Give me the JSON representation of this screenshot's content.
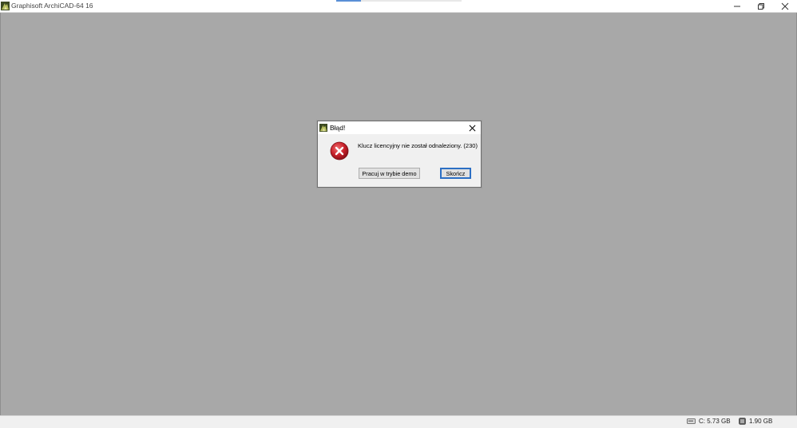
{
  "window": {
    "title": "Graphisoft ArchiCAD-64 16",
    "icon": "archicad-logo-icon",
    "controls": [
      "minimize-icon",
      "restore-icon",
      "close-icon"
    ]
  },
  "dialog": {
    "title": "Błąd!",
    "icon": "archicad-logo-icon",
    "error_icon": "error-icon",
    "message": "Klucz licencyjny nie został odnaleziony. (230)",
    "button_demo": "Pracuj w trybie demo",
    "button_quit": "Skończ"
  },
  "statusbar": {
    "disk_label": "C: 5.73 GB",
    "memory_label": "1.90 GB"
  },
  "colors": {
    "workspace": "#a8a8a8",
    "focus_border": "#2c6fc4",
    "error_red": "#c8202a"
  }
}
